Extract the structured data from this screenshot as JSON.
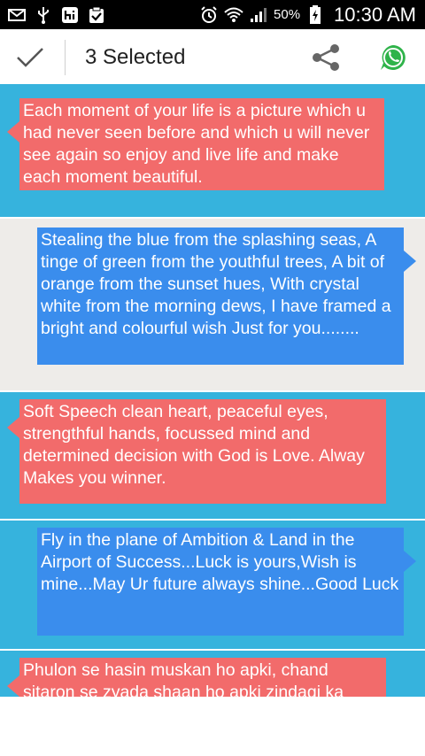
{
  "status_bar": {
    "battery_percent": "50%",
    "time": "10:30 AM",
    "icons": [
      "email-icon",
      "usb-icon",
      "hi-icon",
      "clipboard-check-icon",
      "alarm-icon",
      "wifi-icon",
      "signal-icon",
      "battery-charging-icon"
    ]
  },
  "action_bar": {
    "title": "3 Selected",
    "icons": [
      "check-icon",
      "share-icon",
      "whatsapp-icon"
    ]
  },
  "colors": {
    "selected_row": "#36b3dd",
    "unselected_row": "#eeece9",
    "red_bubble": "#f26b6b",
    "blue_bubble": "#3a8ded"
  },
  "messages": [
    {
      "text": "Each moment of your life is a picture which u had never seen before and which u will never see again so enjoy and live life and make each moment beautiful.",
      "selected": true,
      "side": "left"
    },
    {
      "text": "Stealing the blue from the splashing seas, A tinge of green from the youthful trees, A bit of orange from the sunset hues, With crystal white from the morning dews, I have framed a bright and colourful wish Just for you........",
      "selected": false,
      "side": "right"
    },
    {
      "text": "Soft Speech clean heart, peaceful eyes, strengthful hands, focussed mind and determined decision with God is Love. Alway Makes you winner.",
      "selected": true,
      "side": "left"
    },
    {
      "text": "Fly in the plane of Ambition & Land in the Airport of Success...Luck is yours,Wish is mine...May Ur future always shine...Good Luck",
      "selected": true,
      "side": "right"
    },
    {
      "text": "Phulon se hasin muskan ho apki, chand sitaron se zyada shaan ho apki zindagi ka",
      "selected": true,
      "side": "left"
    }
  ]
}
